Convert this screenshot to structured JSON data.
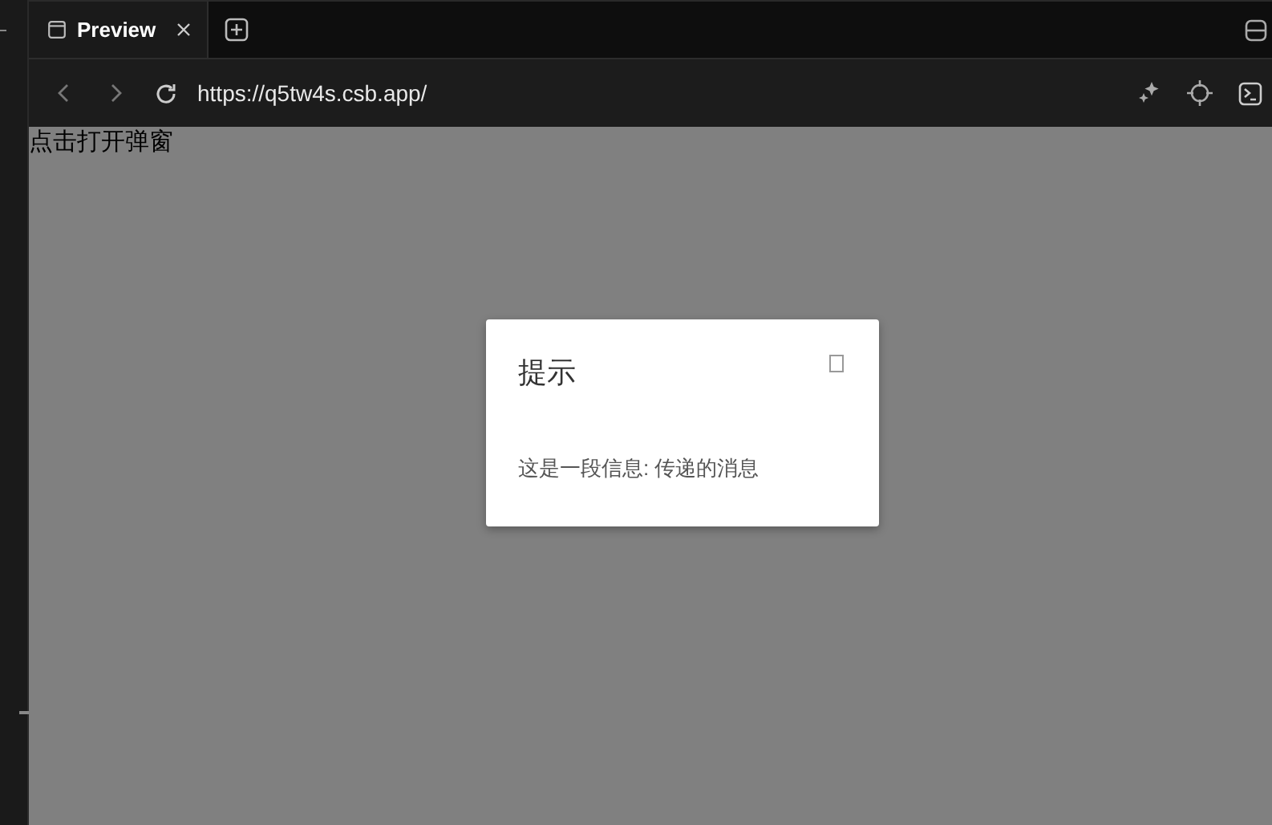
{
  "tabs": [
    {
      "label": "Preview",
      "selected": true
    }
  ],
  "address_bar": {
    "url": "https://q5tw4s.csb.app/"
  },
  "page": {
    "link_text": "点击打开弹窗"
  },
  "dialog": {
    "title": "提示",
    "message": "这是一段信息: 传递的消息"
  }
}
